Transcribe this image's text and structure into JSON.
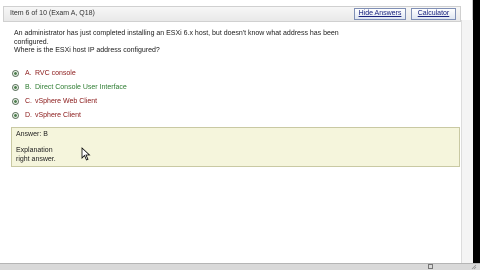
{
  "header": {
    "item_counter": "Item 6 of 10  (Exam A, Q18)",
    "hide_answers_label": "Hide Answers",
    "calculator_label": "Calculator"
  },
  "question": {
    "line1": "An administrator has just completed installing an ESXi 6.x host, but doesn't know what address has been",
    "line2": "configured.",
    "line3": "Where is the ESXi host IP address configured?"
  },
  "options": [
    {
      "letter": "A.",
      "text": "RVC console",
      "correct": false
    },
    {
      "letter": "B.",
      "text": "Direct Console User Interface",
      "correct": true
    },
    {
      "letter": "C.",
      "text": "vSphere Web Client",
      "correct": false
    },
    {
      "letter": "D.",
      "text": "vSphere Client",
      "correct": false
    }
  ],
  "answer": {
    "label": "Answer: B",
    "explanation_title": "Explanation",
    "explanation_text": "right answer."
  },
  "status_bar": {
    "left_text": "",
    "zoom": ""
  },
  "colors": {
    "correct_option": "#2e7d32",
    "incorrect_option": "#8b1a1a",
    "answer_box_bg": "#f5f5dc",
    "button_text": "#1a237e"
  },
  "icons": {
    "cursor": "mouse-pointer-icon",
    "radio": "radio-button-icon"
  }
}
